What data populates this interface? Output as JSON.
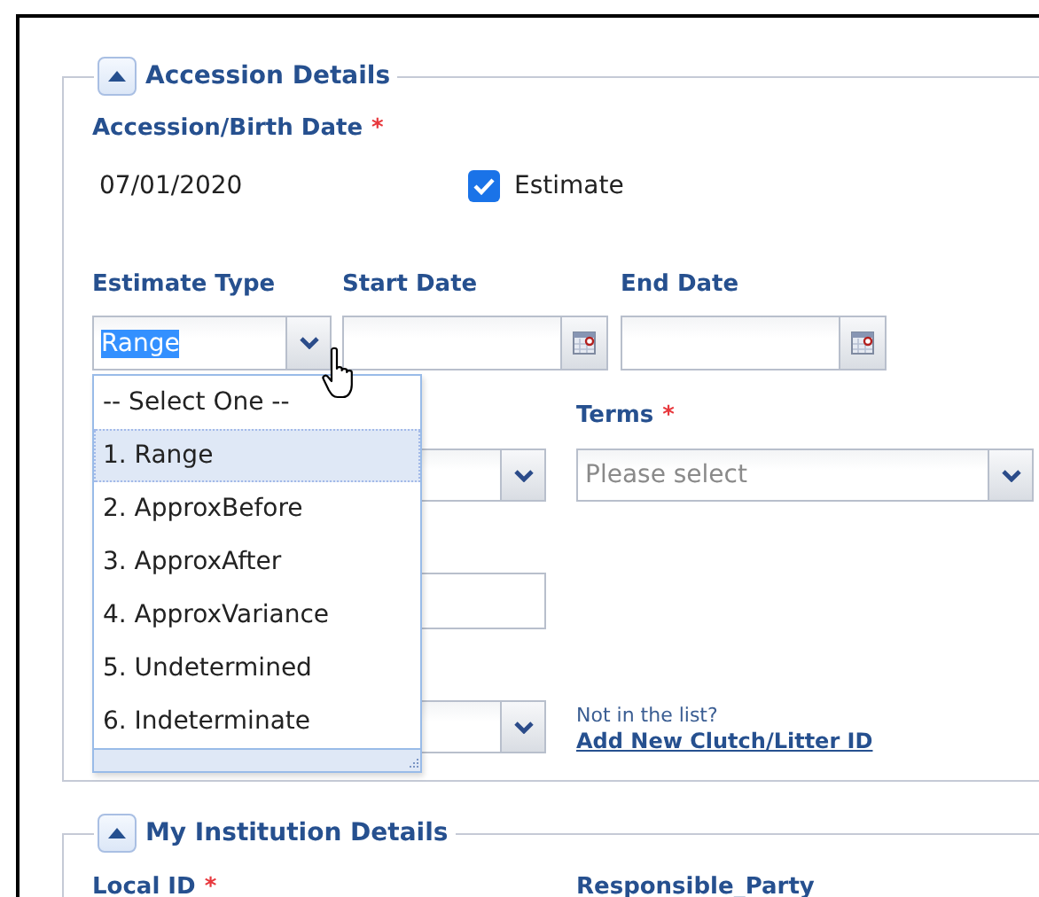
{
  "accession_details": {
    "title": "Accession Details",
    "expanded": true,
    "birth_date": {
      "label": "Accession/Birth Date",
      "required_mark": "*",
      "value": "07/01/2020"
    },
    "estimate": {
      "label": "Estimate",
      "checked": true
    },
    "estimate_type": {
      "label": "Estimate Type",
      "value": "Range",
      "open": true,
      "options": [
        {
          "label": "-- Select One --",
          "selected": false
        },
        {
          "label": "1. Range",
          "selected": true
        },
        {
          "label": "2. ApproxBefore",
          "selected": false
        },
        {
          "label": "3. ApproxAfter",
          "selected": false
        },
        {
          "label": "4. ApproxVariance",
          "selected": false
        },
        {
          "label": "5. Undetermined",
          "selected": false
        },
        {
          "label": "6. Indeterminate",
          "selected": false
        }
      ]
    },
    "start_date": {
      "label": "Start Date"
    },
    "end_date": {
      "label": "End Date"
    },
    "terms": {
      "label": "Terms",
      "required_mark": "*",
      "placeholder": "Please select"
    },
    "clutch": {
      "hint": "Not in the list?",
      "link": "Add New Clutch/Litter ID"
    }
  },
  "institution_details": {
    "title": "My Institution Details",
    "expanded": true,
    "fields": [
      {
        "label": "Local ID",
        "required_mark": "*"
      },
      {
        "label": "Responsible_Party"
      }
    ]
  }
}
